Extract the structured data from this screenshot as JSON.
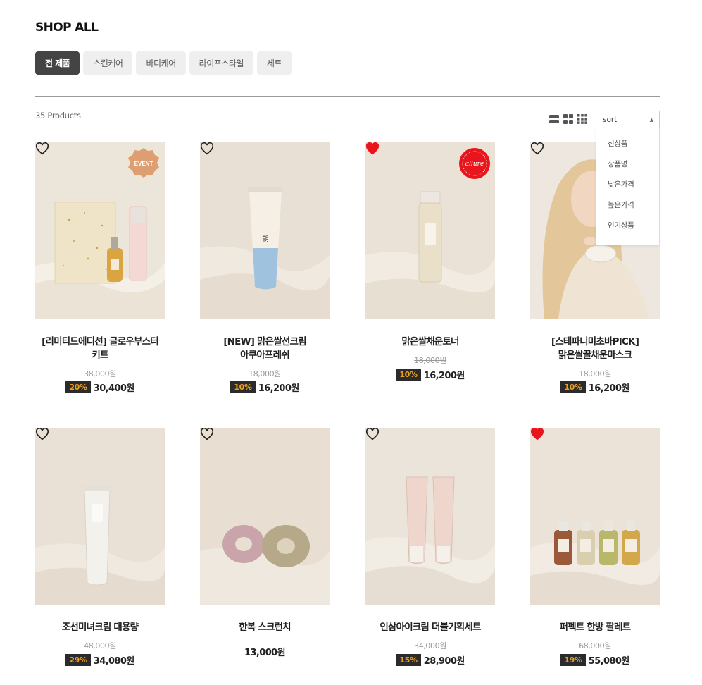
{
  "page": {
    "title": "SHOP ALL",
    "product_count": "35 Products"
  },
  "tabs": [
    {
      "label": "전 제품",
      "active": true
    },
    {
      "label": "스킨케어",
      "active": false
    },
    {
      "label": "바디케어",
      "active": false
    },
    {
      "label": "라이프스타일",
      "active": false
    },
    {
      "label": "세트",
      "active": false
    }
  ],
  "view_icons": [
    "list-view-icon",
    "grid-2-view-icon",
    "grid-3-view-icon"
  ],
  "sort": {
    "label": "sort",
    "options": [
      "신상품",
      "상품명",
      "낮은가격",
      "높은가격",
      "인기상품"
    ]
  },
  "badges": {
    "event": "EVENT",
    "allure": "allure"
  },
  "colors": {
    "accent_discount": "#f0a020",
    "heart_filled": "#e8161c",
    "tab_active_bg": "#444444"
  },
  "products": [
    {
      "name_lines": [
        "[리미티드에디션] 글로우부스터",
        "키트"
      ],
      "original_price": "38,000원",
      "discount": "20%",
      "price": "30,400원",
      "favorited": false,
      "badge": "event"
    },
    {
      "name_lines": [
        "[NEW] 맑은쌀선크림",
        "아쿠아프레쉬"
      ],
      "original_price": "18,000원",
      "discount": "10%",
      "price": "16,200원",
      "favorited": false,
      "badge": ""
    },
    {
      "name_lines": [
        "맑은쌀채운토너"
      ],
      "original_price": "18,000원",
      "discount": "10%",
      "price": "16,200원",
      "favorited": true,
      "badge": "allure"
    },
    {
      "name_lines": [
        "[스테파니미초바PICK]",
        "맑은쌀꿀채운마스크"
      ],
      "original_price": "18,000원",
      "discount": "10%",
      "price": "16,200원",
      "favorited": false,
      "badge": ""
    },
    {
      "name_lines": [
        "조선미녀크림 대용량"
      ],
      "original_price": "48,000원",
      "discount": "29%",
      "price": "34,080원",
      "favorited": false,
      "badge": ""
    },
    {
      "name_lines": [
        "한복 스크런치"
      ],
      "original_price": "",
      "discount": "",
      "price": "13,000원",
      "favorited": false,
      "badge": ""
    },
    {
      "name_lines": [
        "인삼아이크림 더블기획세트"
      ],
      "original_price": "34,000원",
      "discount": "15%",
      "price": "28,900원",
      "favorited": false,
      "badge": ""
    },
    {
      "name_lines": [
        "퍼펙트 한방 팔레트"
      ],
      "original_price": "68,000원",
      "discount": "19%",
      "price": "55,080원",
      "favorited": true,
      "badge": ""
    }
  ]
}
